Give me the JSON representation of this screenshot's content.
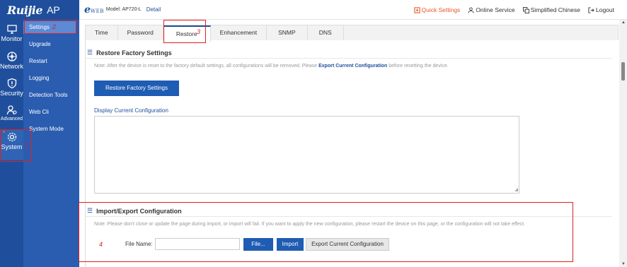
{
  "brand": {
    "logo": "Ruijie",
    "product": "AP"
  },
  "header": {
    "eweb": "e",
    "eweb_small": "WEB",
    "model": "Model: AP720-L",
    "detail": "Detail",
    "quick_settings": "Quick Settings",
    "online_service": "Online Service",
    "language": "Simplified Chinese",
    "logout": "Logout"
  },
  "rail": {
    "monitor": "Monitor",
    "network": "Network",
    "security": "Security",
    "advanced": "Advanced",
    "system": "System"
  },
  "subnav": {
    "items": [
      "Settings",
      "Upgrade",
      "Restart",
      "Logging",
      "Detection Tools",
      "Web Cli",
      "System Mode"
    ]
  },
  "tabs": [
    "Time",
    "Password",
    "Restore",
    "Enhancement",
    "SNMP",
    "DNS"
  ],
  "restore": {
    "title": "Restore Factory Settings",
    "note_pre": "Note: After the device is reset to the factory default settings, all configurations will be removed. Please ",
    "note_link": "Export Current Configuration",
    "note_post": " before resetting the device.",
    "button": "Restore Factory Settings",
    "display_label": "Display Current Configuration"
  },
  "import_export": {
    "title": "Import/Export Configuration",
    "note": "Note: Please don't close or update the page during import, or import will fail. If you want to apply the new configuration, please restart the device on this page, or the configuration will not take effect.",
    "file_label": "File Name:",
    "file_value": "",
    "file_button": "File...",
    "import_button": "Import",
    "export_button": "Export Current Configuration"
  },
  "annotations": {
    "n1": "1",
    "n2": "2",
    "n3": "3",
    "n4": "4"
  },
  "colors": {
    "nav": "#1f4f9c",
    "accent": "#1f5cb3",
    "highlight": "#e02020",
    "quick": "#e8572a"
  }
}
